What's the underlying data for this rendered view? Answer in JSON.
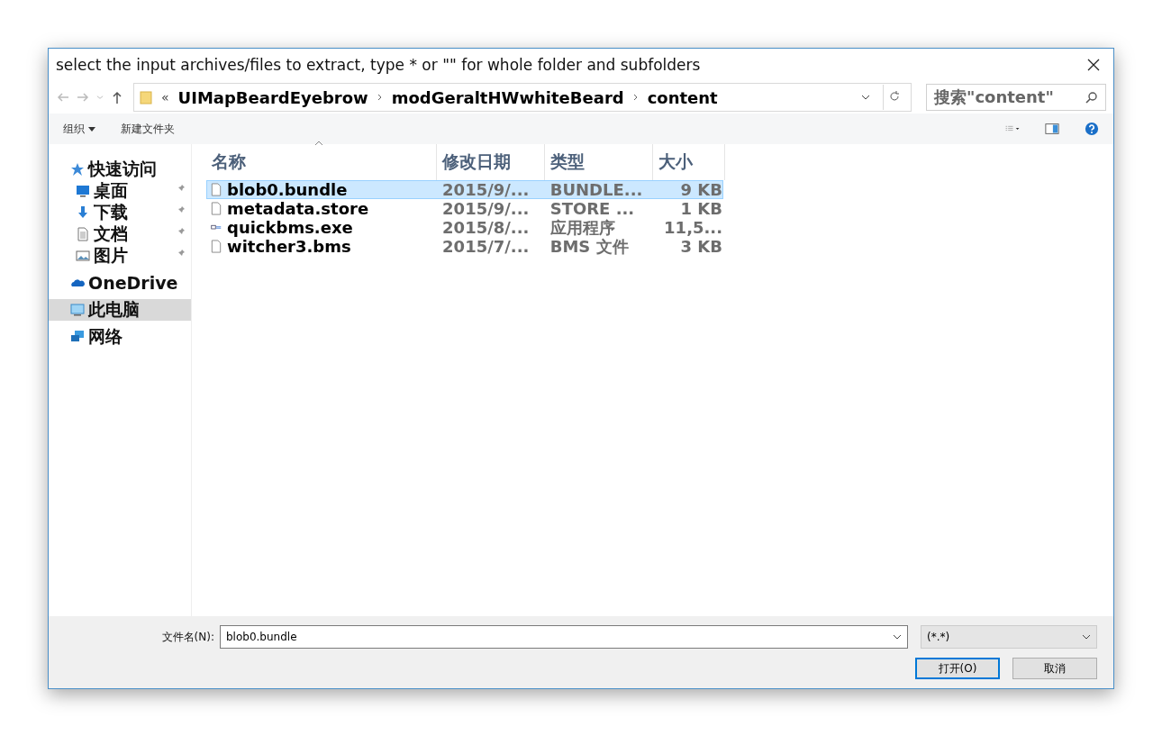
{
  "window": {
    "title": "select the input archives/files to extract, type * or \"\" for whole folder and subfolders"
  },
  "address_bar": {
    "overflow": "«",
    "path": [
      "UIMapBeardEyebrow",
      "modGeraltHWwhiteBeard",
      "content"
    ]
  },
  "search": {
    "placeholder": "搜索\"content\""
  },
  "toolbar": [
    {
      "label": "组织",
      "dropdown": true
    },
    {
      "label": "新建文件夹",
      "dropdown": false
    }
  ],
  "sidebar": {
    "items": [
      {
        "label": "快速访问",
        "kind": "star",
        "selected": false,
        "children": [
          {
            "label": "桌面",
            "kind": "desktop",
            "selected": false,
            "pinned": true
          },
          {
            "label": "下载",
            "kind": "download",
            "selected": false,
            "pinned": true
          },
          {
            "label": "文档",
            "kind": "document",
            "selected": false,
            "pinned": true
          },
          {
            "label": "图片",
            "kind": "picture",
            "selected": false,
            "pinned": true
          }
        ]
      },
      {
        "label": "OneDrive",
        "kind": "cloud",
        "selected": false
      },
      {
        "label": "此电脑",
        "kind": "computer",
        "selected": true
      },
      {
        "label": "网络",
        "kind": "network",
        "selected": false
      }
    ]
  },
  "table": {
    "columns": [
      {
        "label": "名称",
        "sorted": true
      },
      {
        "label": "修改日期",
        "sorted": false
      },
      {
        "label": "类型",
        "sorted": false
      },
      {
        "label": "大小",
        "sorted": false
      }
    ],
    "rows": [
      {
        "name": "blob0.bundle",
        "date": "2015/9/...",
        "type": "BUNDLE...",
        "size": "9 KB",
        "kind": "file",
        "selected": true
      },
      {
        "name": "metadata.store",
        "date": "2015/9/...",
        "type": "STORE ...",
        "size": "1 KB",
        "kind": "file",
        "selected": false
      },
      {
        "name": "quickbms.exe",
        "date": "2015/8/...",
        "type": "应用程序",
        "size": "11,5...",
        "kind": "exe",
        "selected": false
      },
      {
        "name": "witcher3.bms",
        "date": "2015/7/...",
        "type": "BMS 文件",
        "size": "3 KB",
        "kind": "file",
        "selected": false
      }
    ]
  },
  "footer": {
    "filename_label": "文件名(N):",
    "filename": "blob0.bundle",
    "filter": "(*.*)",
    "buttons": [
      {
        "label": "打开(O)",
        "default": true
      },
      {
        "label": "取消",
        "default": false
      }
    ]
  }
}
